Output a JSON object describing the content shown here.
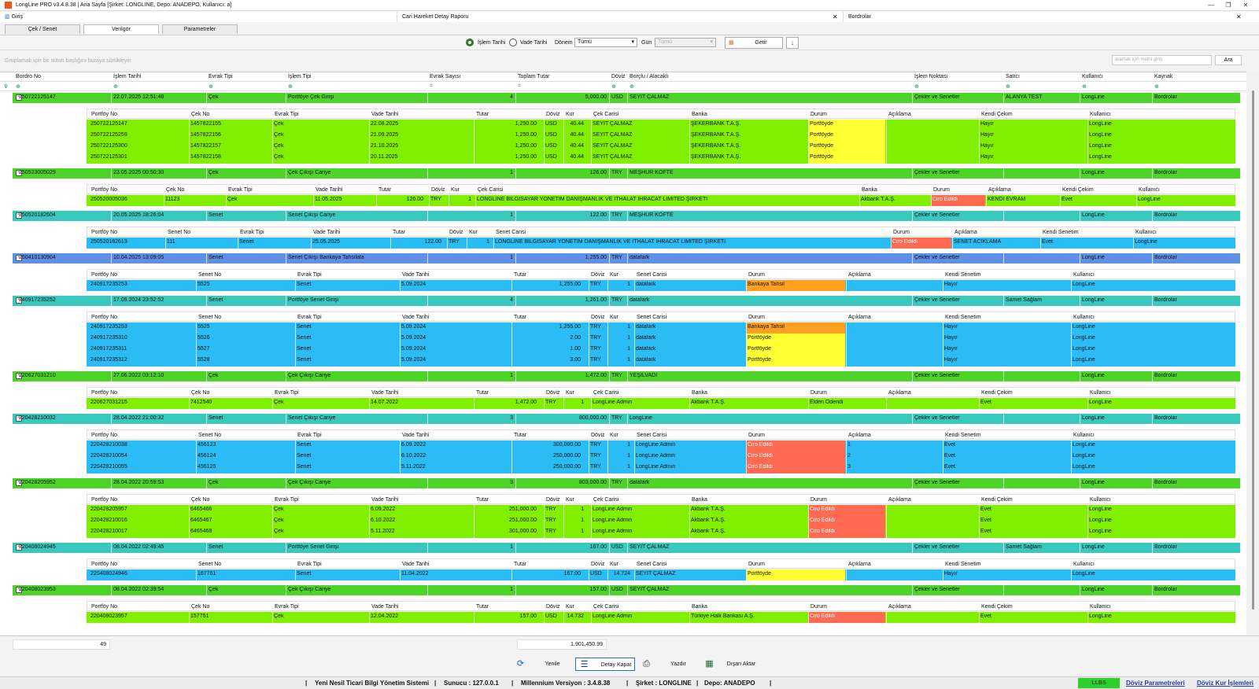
{
  "app": {
    "title": "LongLine PRO v3.4.8.38 | Ana Sayfa [Şirket: LONGLINE, Depo: ANADEPO, Kullanıcı: a]"
  },
  "tabs": [
    {
      "label": "Giriş"
    },
    {
      "label": "Cari Hareket Detay Raporu"
    },
    {
      "label": "Bordrolar"
    }
  ],
  "subtabs": [
    {
      "label": "Çek / Senet"
    },
    {
      "label": "Verilgör"
    },
    {
      "label": "Parametreler"
    }
  ],
  "filters": {
    "islem_tarihi": "İşlem Tarihi",
    "vade_tarihi": "Vade Tarihi",
    "donem_label": "Dönem",
    "donem_value": "Tümü",
    "gun_label": "Gün",
    "gun_value": "Tümü",
    "getir": "Getir"
  },
  "group_hint": "Gruplamak için bir sütun başlığını buraya sürükleyin",
  "search": {
    "placeholder": "aramak için metni girin",
    "button": "Ara"
  },
  "columns": [
    "Bordro No",
    "İşlem Tarihi",
    "Evrak Tipi",
    "İşlem Tipi",
    "Evrak Sayısı",
    "Toplam Tutar",
    "Döviz",
    "Borçlu / Alacaklı",
    "İşlem Noktası",
    "Satıcı",
    "Kullanıcı",
    "Kaynak"
  ],
  "colors": {
    "green": "#80f000",
    "teal": "#5fcfc6",
    "blue": "#2bbcf5",
    "indigo": "#5f90e8",
    "yellow": "#ffff33",
    "orange": "#ffa020",
    "red": "#ff6a50"
  },
  "groups": [
    {
      "color": "green",
      "bordro": "250722125147",
      "tarih": "22.07.2025 12:51:48",
      "evrak_tipi": "Çek",
      "islem_tipi": "Portföye Çek Girişi",
      "sayi": "4",
      "tutar": "5,000.00",
      "doviz": "USD",
      "borclu": "SEYİT ÇALMAZ",
      "nokta": "Çekler ve Senetler",
      "satici": "ALANYA TEST",
      "kullanici": "LongLine",
      "kaynak": "Bordrolar",
      "sub_headers": [
        "Portföy No",
        "Çek No",
        "Evrak Tipi",
        "Vade Tarihi",
        "Tutar",
        "Döviz",
        "Kur",
        "Çek Carisi",
        "Banka",
        "Durum",
        "Açıklama",
        "Kendi Çekim",
        "Kullanıcı"
      ],
      "rows": [
        [
          "250722125147",
          "1457822155",
          "Çek",
          "22.08.2025",
          "1,250.00",
          "USD",
          "40.44",
          "SEYİT ÇALMAZ",
          "ŞEKERBANK T.A.Ş.",
          "Portföyde",
          "",
          "Hayır",
          "LongLine"
        ],
        [
          "250722125259",
          "1457822156",
          "Çek",
          "21.09.2025",
          "1,250.00",
          "USD",
          "40.44",
          "SEYİT ÇALMAZ",
          "ŞEKERBANK T.A.Ş.",
          "Portföyde",
          "",
          "Hayır",
          "LongLine"
        ],
        [
          "250722125300",
          "1457822157",
          "Çek",
          "21.10.2025",
          "1,250.00",
          "USD",
          "40.44",
          "SEYİT ÇALMAZ",
          "ŞEKERBANK T.A.Ş.",
          "Portföyde",
          "",
          "Hayır",
          "LongLine"
        ],
        [
          "250722125301",
          "1457822158",
          "Çek",
          "20.11.2025",
          "1,250.00",
          "USD",
          "40.44",
          "SEYİT ÇALMAZ",
          "ŞEKERBANK T.A.Ş.",
          "Portföyde",
          "",
          "Hayır",
          "LongLine"
        ]
      ]
    },
    {
      "color": "green",
      "bordro": "250523005029",
      "tarih": "23.05.2025 00:50:30",
      "evrak_tipi": "Çek",
      "islem_tipi": "Çek Çıkışı Cariye",
      "sayi": "1",
      "tutar": "126.00",
      "doviz": "TRY",
      "borclu": "MEŞHUR KÖFTE",
      "nokta": "Çekler ve Senetler",
      "satici": "",
      "kullanici": "LongLine",
      "kaynak": "Bordrolar",
      "sub_headers": [
        "Portföy No",
        "Çek No",
        "Evrak Tipi",
        "Vade Tarihi",
        "Tutar",
        "Döviz",
        "Kur",
        "Çek Carisi",
        "Banka",
        "Durum",
        "Açıklama",
        "Kendi Çekim",
        "Kullanıcı"
      ],
      "rows": [
        [
          "250520005036",
          "11123",
          "Çek",
          "11.05.2025",
          "126.00",
          "TRY",
          "1",
          "LONGLINE BİLGİSAYAR YÖNETİM DANIŞMANLIK VE İTHALAT İHRACAT LİMİTED ŞİRKETİ",
          "Akbank T.A.Ş.",
          "Ciro Edildi",
          "KENDİ EVRAM",
          "Evet",
          "LongLine"
        ]
      ]
    },
    {
      "color": "teal",
      "bordro": "250520182604",
      "tarih": "20.05.2025 18:26:04",
      "evrak_tipi": "Senet",
      "islem_tipi": "Senet Çıkışı Cariye",
      "sayi": "1",
      "tutar": "122.00",
      "doviz": "TRY",
      "borclu": "MEŞHUR KÖFTE",
      "nokta": "Çekler ve Senetler",
      "satici": "",
      "kullanici": "LongLine",
      "kaynak": "Bordrolar",
      "sub_headers": [
        "Portföy No",
        "Senet No",
        "Evrak Tipi",
        "Vade Tarihi",
        "Tutar",
        "Döviz",
        "Kur",
        "Senet Carisi",
        "Durum",
        "Açıklama",
        "Kendi Senetim",
        "Kullanıcı"
      ],
      "rows": [
        [
          "250520182613",
          "111",
          "Senet",
          "25.05.2025",
          "122.00",
          "TRY",
          "1",
          "LONGLINE BİLGİSAYAR YÖNETİM DANIŞMANLIK VE İTHALAT İHRACAT LİMİTED ŞİRKETİ",
          "Ciro Edildi",
          "SENET ACIKLAMA",
          "Evet",
          "LongLine"
        ]
      ]
    },
    {
      "color": "indigo",
      "bordro": "250410130904",
      "tarih": "10.04.2025 13:09:05",
      "evrak_tipi": "Senet",
      "islem_tipi": "Senet Çıkışı Bankaya Tahsilata",
      "sayi": "1",
      "tutar": "1,255.00",
      "doviz": "TRY",
      "borclu": "datafark",
      "nokta": "Çekler ve Senetler",
      "satici": "",
      "kullanici": "LongLine",
      "kaynak": "Bordrolar",
      "sub_headers": [
        "Portföy No",
        "Senet No",
        "Evrak Tipi",
        "Vade Tarihi",
        "Tutar",
        "Döviz",
        "Kur",
        "Senet Carisi",
        "Durum",
        "Açıklama",
        "Kendi Senetim",
        "Kullanıcı"
      ],
      "rows": [
        [
          "240917235253",
          "5525",
          "Senet",
          "5.09.2024",
          "1,255.00",
          "TRY",
          "1",
          "datafark",
          "Bankaya Tahsil",
          "",
          "Hayır",
          "LongLine"
        ]
      ]
    },
    {
      "color": "teal",
      "bordro": "240917235252",
      "tarih": "17.09.2024 23:52:52",
      "evrak_tipi": "Senet",
      "islem_tipi": "Portföye Senet Girişi",
      "sayi": "4",
      "tutar": "1,261.00",
      "doviz": "TRY",
      "borclu": "datafark",
      "nokta": "Çekler ve Senetler",
      "satici": "Samet Sağlam",
      "kullanici": "LongLine",
      "kaynak": "Bordrolar",
      "sub_headers": [
        "Portföy No",
        "Senet No",
        "Evrak Tipi",
        "Vade Tarihi",
        "Tutar",
        "Döviz",
        "Kur",
        "Senet Carisi",
        "Durum",
        "Açıklama",
        "Kendi Senetim",
        "Kullanıcı"
      ],
      "rows": [
        [
          "240917235253",
          "5525",
          "Senet",
          "5.09.2024",
          "1,255.00",
          "TRY",
          "1",
          "datafark",
          "Bankaya Tahsil",
          "",
          "Hayır",
          "LongLine"
        ],
        [
          "240917235310",
          "5526",
          "Senet",
          "5.09.2024",
          "2.00",
          "TRY",
          "1",
          "datafark",
          "Portföyde",
          "",
          "Hayır",
          "LongLine"
        ],
        [
          "240917235311",
          "5527",
          "Senet",
          "5.09.2024",
          "1.00",
          "TRY",
          "1",
          "datafark",
          "Portföyde",
          "",
          "Hayır",
          "LongLine"
        ],
        [
          "240917235312",
          "5528",
          "Senet",
          "5.09.2024",
          "3.00",
          "TRY",
          "1",
          "datafark",
          "Portföyde",
          "",
          "Hayır",
          "LongLine"
        ]
      ]
    },
    {
      "color": "green",
      "bordro": "220627031210",
      "tarih": "27.06.2022 03:12:10",
      "evrak_tipi": "Çek",
      "islem_tipi": "Çek Çıkışı Cariye",
      "sayi": "1",
      "tutar": "1,472.00",
      "doviz": "TRY",
      "borclu": "YEŞİLVADİ",
      "nokta": "Çekler ve Senetler",
      "satici": "",
      "kullanici": "LongLine",
      "kaynak": "Bordrolar",
      "sub_headers": [
        "Portföy No",
        "Çek No",
        "Evrak Tipi",
        "Vade Tarihi",
        "Tutar",
        "Döviz",
        "Kur",
        "Çek Carisi",
        "Banka",
        "Durum",
        "Açıklama",
        "Kendi Çekim",
        "Kullanıcı"
      ],
      "rows": [
        [
          "220627031215",
          "7412540",
          "Çek",
          "14.07.2022",
          "1,472.00",
          "TRY",
          "1",
          "LongLine Admin",
          "Akbank T.A.Ş.",
          "Elden Ödendi",
          "",
          "Evet",
          "LongLine"
        ]
      ]
    },
    {
      "color": "teal",
      "bordro": "220428210032",
      "tarih": "28.04.2022 21:00:32",
      "evrak_tipi": "Senet",
      "islem_tipi": "Senet Çıkışı Cariye",
      "sayi": "3",
      "tutar": "800,000.00",
      "doviz": "TRY",
      "borclu": "LongLine",
      "nokta": "Çekler ve Senetler",
      "satici": "",
      "kullanici": "LongLine",
      "kaynak": "Bordrolar",
      "sub_headers": [
        "Portföy No",
        "Senet No",
        "Evrak Tipi",
        "Vade Tarihi",
        "Tutar",
        "Döviz",
        "Kur",
        "Senet Carisi",
        "Durum",
        "Açıklama",
        "Kendi Senetim",
        "Kullanıcı"
      ],
      "rows": [
        [
          "220428210038",
          "456123",
          "Senet",
          "6.09.2022",
          "300,000.00",
          "TRY",
          "1",
          "LongLine Admin",
          "Ciro Edildi",
          "1",
          "Evet",
          "LongLine"
        ],
        [
          "220428210054",
          "456124",
          "Senet",
          "6.10.2022",
          "250,000.00",
          "TRY",
          "1",
          "LongLine Admin",
          "Ciro Edildi",
          "2",
          "Evet",
          "LongLine"
        ],
        [
          "220428210055",
          "456125",
          "Senet",
          "5.11.2022",
          "250,000.00",
          "TRY",
          "1",
          "LongLine Admin",
          "Ciro Edildi",
          "3",
          "Evet",
          "LongLine"
        ]
      ]
    },
    {
      "color": "green",
      "bordro": "220428205952",
      "tarih": "28.04.2022 20:59:53",
      "evrak_tipi": "Çek",
      "islem_tipi": "Çek Çıkışı Cariye",
      "sayi": "3",
      "tutar": "803,000.00",
      "doviz": "TRY",
      "borclu": "datafark",
      "nokta": "Çekler ve Senetler",
      "satici": "",
      "kullanici": "LongLine",
      "kaynak": "Bordrolar",
      "sub_headers": [
        "Portföy No",
        "Çek No",
        "Evrak Tipi",
        "Vade Tarihi",
        "Tutar",
        "Döviz",
        "Kur",
        "Çek Carisi",
        "Banka",
        "Durum",
        "Açıklama",
        "Kendi Çekim",
        "Kullanıcı"
      ],
      "rows": [
        [
          "220428205957",
          "6465466",
          "Çek",
          "6.09.2022",
          "251,000.00",
          "TRY",
          "1",
          "LongLine Admin",
          "Akbank T.A.Ş.",
          "Ciro Edildi",
          "",
          "Evet",
          "LongLine"
        ],
        [
          "220428210016",
          "6465467",
          "Çek",
          "6.10.2022",
          "251,000.00",
          "TRY",
          "1",
          "LongLine Admin",
          "Akbank T.A.Ş.",
          "Ciro Edildi",
          "",
          "Evet",
          "LongLine"
        ],
        [
          "220428210017",
          "6465468",
          "Çek",
          "5.11.2022",
          "301,000.00",
          "TRY",
          "1",
          "LongLine Admin",
          "Akbank T.A.Ş.",
          "Ciro Edildi",
          "",
          "Evet",
          "LongLine"
        ]
      ]
    },
    {
      "color": "teal",
      "bordro": "220408024945",
      "tarih": "08.04.2022 02:49:45",
      "evrak_tipi": "Senet",
      "islem_tipi": "Portföye Senet Girişi",
      "sayi": "1",
      "tutar": "167.00",
      "doviz": "USD",
      "borclu": "SEYİT ÇALMAZ",
      "nokta": "Çekler ve Senetler",
      "satici": "Samet Sağlam",
      "kullanici": "LongLine",
      "kaynak": "Bordrolar",
      "sub_headers": [
        "Portföy No",
        "Senet No",
        "Evrak Tipi",
        "Vade Tarihi",
        "Tutar",
        "Döviz",
        "Kur",
        "Senet Carisi",
        "Durum",
        "Açıklama",
        "Kendi Senetim",
        "Kullanıcı"
      ],
      "rows": [
        [
          "220408024946",
          "167761",
          "Senet",
          "11.04.2022",
          "167.00",
          "USD",
          "14.724",
          "SEYİT ÇALMAZ",
          "Portföyde",
          "",
          "Hayır",
          "LongLine"
        ]
      ]
    },
    {
      "color": "green",
      "bordro": "220408023953",
      "tarih": "08.04.2022 02:39:54",
      "evrak_tipi": "Çek",
      "islem_tipi": "Çek Çıkışı Cariye",
      "sayi": "1",
      "tutar": "157.00",
      "doviz": "USD",
      "borclu": "SEYİT ÇALMAZ",
      "nokta": "Çekler ve Senetler",
      "satici": "",
      "kullanici": "LongLine",
      "kaynak": "Bordrolar",
      "sub_headers": [
        "Portföy No",
        "Çek No",
        "Evrak Tipi",
        "Vade Tarihi",
        "Tutar",
        "Döviz",
        "Kur",
        "Çek Carisi",
        "Banka",
        "Durum",
        "Açıklama",
        "Kendi Çekim",
        "Kullanıcı"
      ],
      "rows": [
        [
          "220408023957",
          "157751",
          "Çek",
          "12.04.2022",
          "157.00",
          "USD",
          "14.732",
          "LongLine Admin",
          "Türkiye Halk Bankası A.Ş.",
          "Ciro Edildi",
          "",
          "Evet",
          "LongLine"
        ]
      ]
    }
  ],
  "footer": {
    "count": "49",
    "total": "1,901,450.99"
  },
  "actions": {
    "yenile": "Yenile",
    "detay_kapat": "Detay Kapat",
    "yazdir": "Yazdır",
    "disari_aktar": "Dışarı Aktar"
  },
  "status": {
    "system": "Yeni Nesil Ticari Bilgi Yönetim Sistemi",
    "sunucu": "Sunucu :  127.0.0.1",
    "version": "Millennium Versiyon :  3.4.8.38",
    "sirket": "Şirket :  LONGLINE",
    "depo": "Depo:  ANADEPO",
    "badge": "LLBS",
    "doviz_param": "Döviz Parametreleri",
    "doviz_kur": "Döviz Kur İşlemleri"
  }
}
